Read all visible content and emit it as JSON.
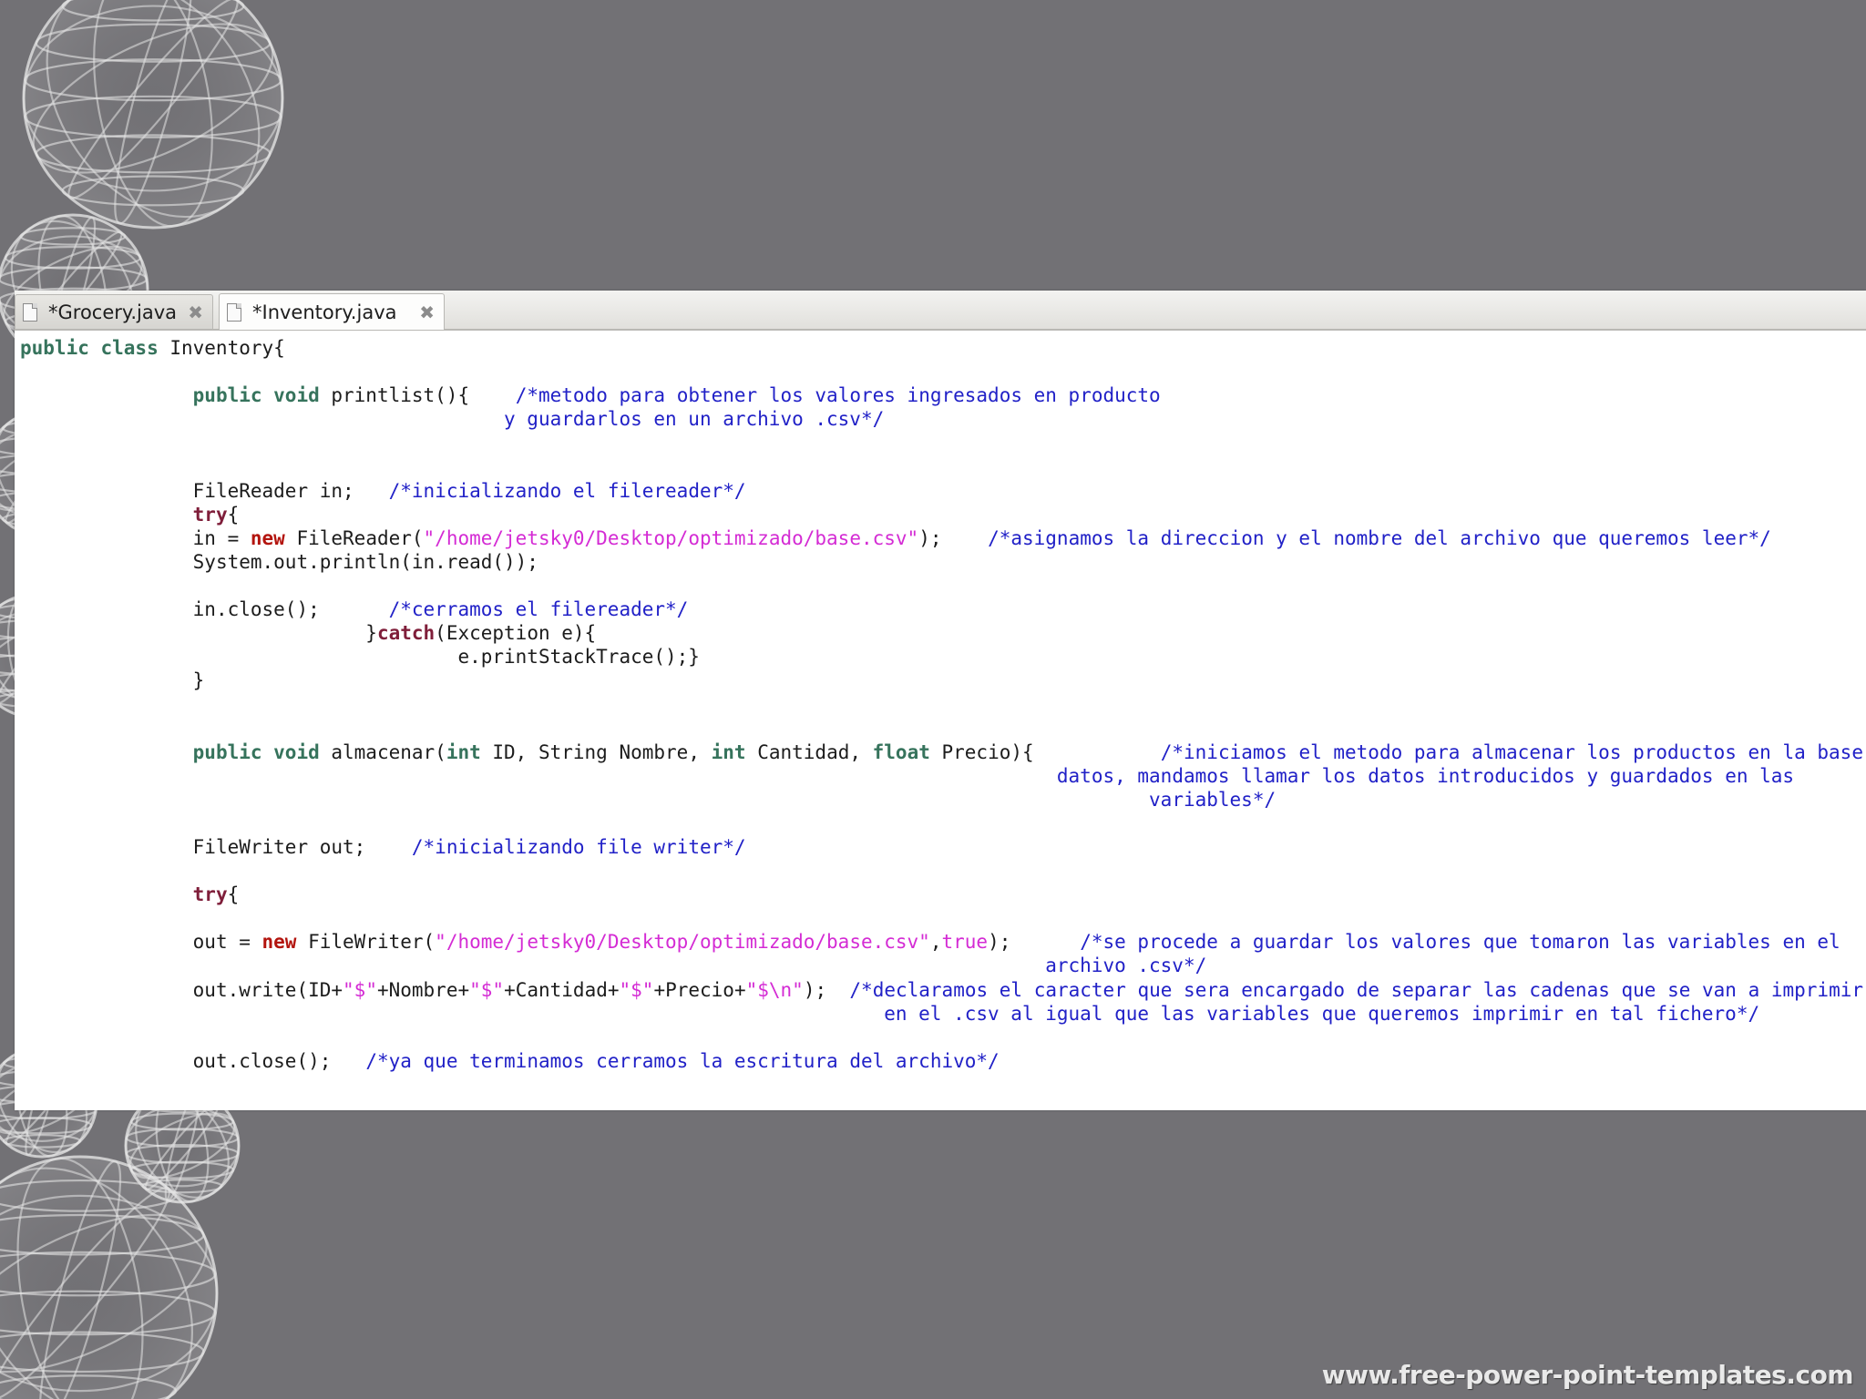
{
  "tabs": [
    {
      "label": "*Grocery.java",
      "active": false
    },
    {
      "label": "*Inventory.java",
      "active": true
    }
  ],
  "code": {
    "class_kw": "public class",
    "class_name": " Inventory{",
    "m1_kw": "public void",
    "m1_sig": " printlist(){",
    "m1_c1": "/*metodo para obtener los valores ingresados en producto",
    "m1_c2": "y guardarlos en un archivo .csv*/",
    "fr_decl": "FileReader in;",
    "fr_cm": "/*inicializando el filereader*/",
    "try1": "try",
    "brace_open": "{",
    "in_assign": "in = ",
    "new_kw": "new",
    "fr_ctor": " FileReader(",
    "path": "\"/home/jetsky0/Desktop/optimizado/base.csv\"",
    "fr_end": ");",
    "fr_path_cm": "/*asignamos la direccion y el nombre del archivo que queremos leer*/",
    "println": "System.out.println(in.read());",
    "in_close": "in.close();",
    "in_close_cm": "/*cerramos el filereader*/",
    "catch_pre": "}",
    "catch_kw": "catch",
    "catch_rest": "(Exception e){",
    "trace": "e.printStackTrace();}",
    "brace_close": "}",
    "m2_kw": "public void",
    "m2_name": " almacenar(",
    "int_kw": "int",
    "m2_p1": " ID, String Nombre, ",
    "m2_p2": " Cantidad, ",
    "float_kw": "float",
    "m2_p3": " Precio){",
    "m2_c1": "/*iniciamos el metodo para almacenar los productos en la base de",
    "m2_c2": "datos, mandamos llamar los datos introducidos y guardados en las",
    "m2_c3": "variables*/",
    "fw_decl": "FileWriter out;",
    "fw_cm": "/*inicializando file writer*/",
    "try2": "try",
    "out_assign": "out = ",
    "fw_ctor": " FileWriter(",
    "comma": ",",
    "true_kw": "true",
    "fw_end": ");",
    "fw_c1": "/*se procede a guardar los valores que tomaron las variables en el",
    "fw_c2": "archivo .csv*/",
    "w1": "out.write(ID+",
    "dollar": "\"$\"",
    "w2": "+Nombre+",
    "w3": "+Cantidad+",
    "w4": "+Precio+",
    "dollar_nl": "\"$\\n\"",
    "w5": ");",
    "w_c1": "/*declaramos el caracter que sera encargado de separar las cadenas que se van a imprimir",
    "w_c2": "en el .csv al igual que las variables que queremos imprimir en tal fichero*/",
    "out_close": "out.close();",
    "out_close_cm": "/*ya que terminamos cerramos la escritura del archivo*/"
  },
  "watermark": "www.free-power-point-templates.com",
  "colors": {
    "background": "#727175",
    "keyword_green": "#36735c",
    "keyword_maroon": "#7f1e3a",
    "keyword_new": "#b3140e",
    "string": "#d42bd4",
    "comment": "#2121c7"
  }
}
